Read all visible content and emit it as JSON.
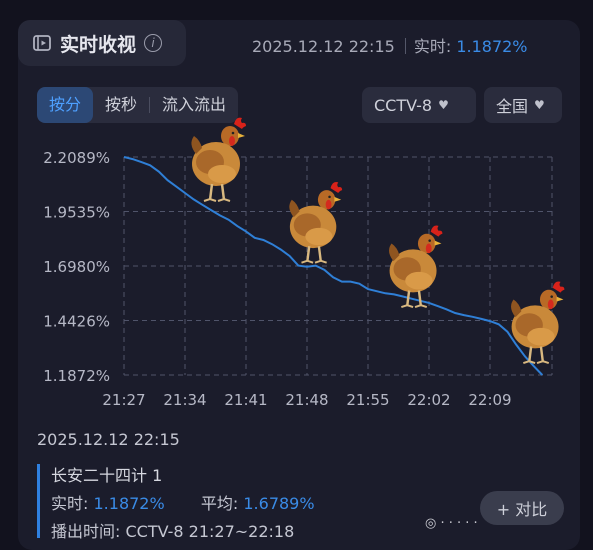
{
  "header": {
    "title": "实时收视",
    "datetime": "2025.12.12 22:15",
    "realtime_label": "实时:",
    "realtime_value": "1.1872%"
  },
  "tabs": [
    "按分",
    "按秒",
    "流入流出"
  ],
  "active_tab": 0,
  "dropdowns": {
    "channel": "CCTV-8",
    "region": "全国"
  },
  "chart_data": {
    "type": "line",
    "x_ticks": [
      "21:27",
      "21:34",
      "21:41",
      "21:48",
      "21:55",
      "22:02",
      "22:09"
    ],
    "y_ticks": [
      "2.2089%",
      "1.9535%",
      "1.6980%",
      "1.4426%",
      "1.1872%"
    ],
    "ylim": [
      1.1872,
      2.2089
    ],
    "x_minutes": [
      "21:27",
      "21:28",
      "21:29",
      "21:30",
      "21:31",
      "21:32",
      "21:33",
      "21:34",
      "21:35",
      "21:36",
      "21:37",
      "21:38",
      "21:39",
      "21:40",
      "21:41",
      "21:42",
      "21:43",
      "21:44",
      "21:45",
      "21:46",
      "21:47",
      "21:48",
      "21:49",
      "21:50",
      "21:51",
      "21:52",
      "21:53",
      "21:54",
      "21:55",
      "21:56",
      "21:57",
      "21:58",
      "21:59",
      "22:00",
      "22:01",
      "22:02",
      "22:03",
      "22:04",
      "22:05",
      "22:06",
      "22:07",
      "22:08",
      "22:09",
      "22:10",
      "22:11",
      "22:12",
      "22:13",
      "22:14",
      "22:15"
    ],
    "values": [
      2.2089,
      2.199,
      2.185,
      2.17,
      2.14,
      2.1,
      2.07,
      2.04,
      2.01,
      1.985,
      1.96,
      1.935,
      1.915,
      1.885,
      1.86,
      1.83,
      1.82,
      1.8,
      1.775,
      1.745,
      1.7,
      1.695,
      1.7,
      1.68,
      1.645,
      1.625,
      1.625,
      1.615,
      1.59,
      1.58,
      1.57,
      1.565,
      1.555,
      1.545,
      1.535,
      1.525,
      1.51,
      1.495,
      1.478,
      1.468,
      1.46,
      1.45,
      1.44,
      1.425,
      1.39,
      1.33,
      1.275,
      1.23,
      1.1872
    ],
    "line_color": "#2f7fd6",
    "grid": true
  },
  "detail": {
    "datetime": "2025.12.12  22:15",
    "program": "长安二十四计 1",
    "realtime_label": "实时:",
    "realtime_value": "1.1872%",
    "average_label": "平均:",
    "average_value": "1.6789%",
    "airtime": "播出时间:  CCTV-8 21:27~22:18"
  },
  "compare_button": "+ 对比",
  "watermark": "◎ ·  ·  ·  ·  ·",
  "colors": {
    "accent": "#3a8be6",
    "panel": "#1b1c2b",
    "background": "#12121e"
  }
}
